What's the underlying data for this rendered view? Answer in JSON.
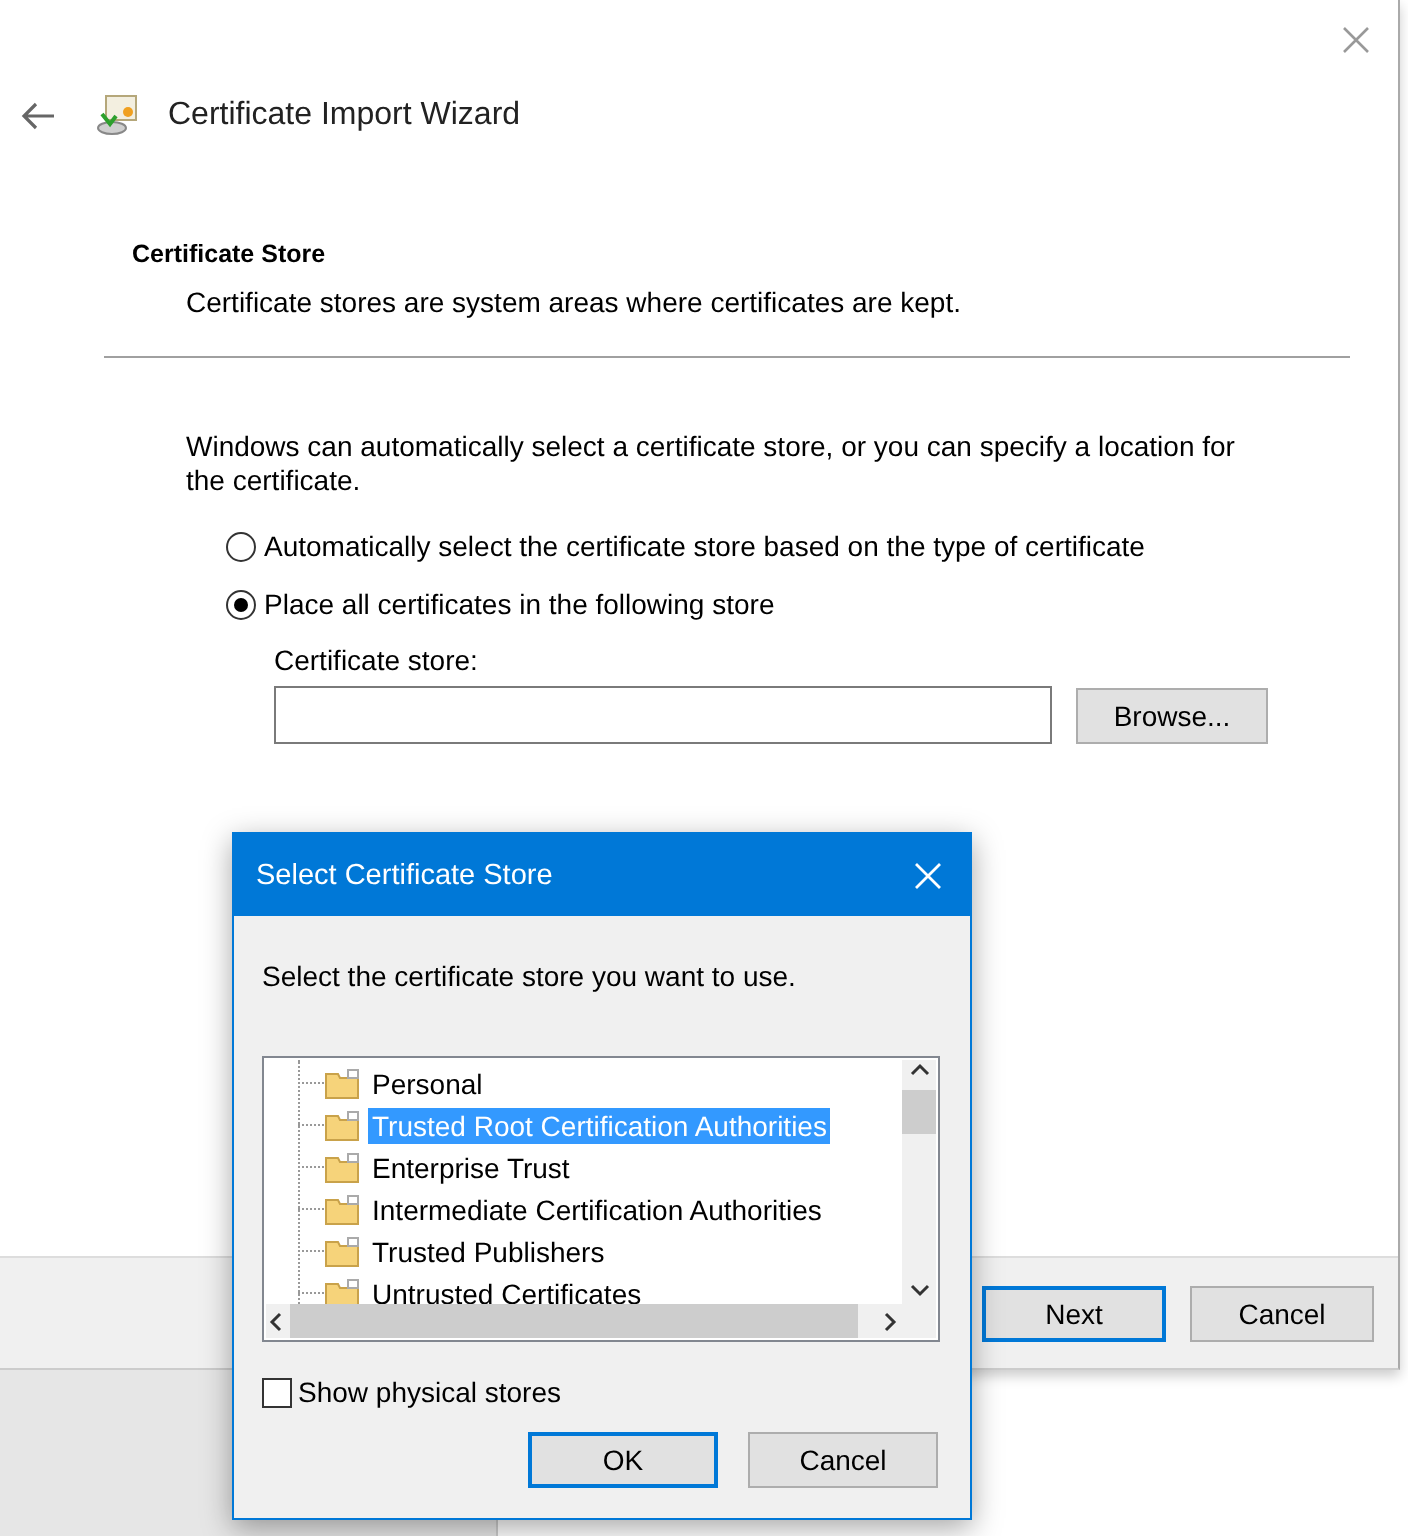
{
  "window": {
    "title": "Certificate Import Wizard"
  },
  "header": {
    "title": "Certificate Store",
    "description": "Certificate stores are system areas where certificates are kept."
  },
  "intro": "Windows can automatically select a certificate store, or you can specify a location for the certificate.",
  "options": [
    {
      "label": "Automatically select the certificate store based on the type of certificate",
      "selected": false
    },
    {
      "label": "Place all certificates in the following store",
      "selected": true
    }
  ],
  "store_field": {
    "label": "Certificate store:",
    "browse": "Browse..."
  },
  "buttons": [
    {
      "label": "Next",
      "default": true
    },
    {
      "label": "Cancel",
      "default": false
    }
  ],
  "dialog": {
    "title": "Select Certificate Store",
    "prompt": "Select the certificate store you want to use.",
    "stores": [
      {
        "label": "Personal",
        "selected": false
      },
      {
        "label": "Trusted Root Certification Authorities",
        "selected": true
      },
      {
        "label": "Enterprise Trust",
        "selected": false
      },
      {
        "label": "Intermediate Certification Authorities",
        "selected": false
      },
      {
        "label": "Trusted Publishers",
        "selected": false
      },
      {
        "label": "Untrusted Certificates",
        "selected": false
      }
    ],
    "show_physical": {
      "label": "Show physical stores",
      "checked": false
    },
    "buttons": [
      {
        "label": "OK",
        "default": true
      },
      {
        "label": "Cancel",
        "default": false
      }
    ]
  }
}
